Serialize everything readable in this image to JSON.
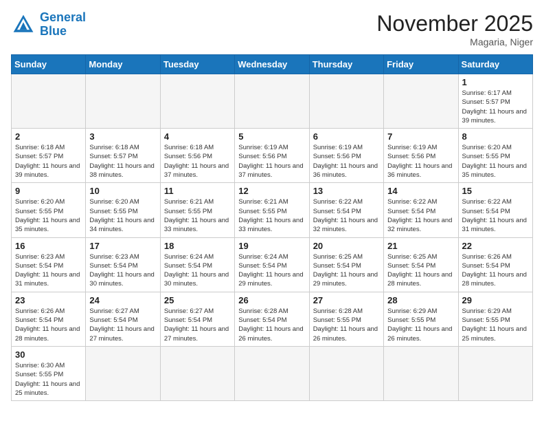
{
  "header": {
    "logo_general": "General",
    "logo_blue": "Blue",
    "month_title": "November 2025",
    "location": "Magaria, Niger"
  },
  "days_of_week": [
    "Sunday",
    "Monday",
    "Tuesday",
    "Wednesday",
    "Thursday",
    "Friday",
    "Saturday"
  ],
  "weeks": [
    {
      "cells": [
        {
          "day": "",
          "empty": true
        },
        {
          "day": "",
          "empty": true
        },
        {
          "day": "",
          "empty": true
        },
        {
          "day": "",
          "empty": true
        },
        {
          "day": "",
          "empty": true
        },
        {
          "day": "",
          "empty": true
        },
        {
          "day": "1",
          "sunrise": "6:17 AM",
          "sunset": "5:57 PM",
          "daylight": "11 hours and 39 minutes."
        }
      ]
    },
    {
      "cells": [
        {
          "day": "2",
          "sunrise": "6:18 AM",
          "sunset": "5:57 PM",
          "daylight": "11 hours and 39 minutes."
        },
        {
          "day": "3",
          "sunrise": "6:18 AM",
          "sunset": "5:57 PM",
          "daylight": "11 hours and 38 minutes."
        },
        {
          "day": "4",
          "sunrise": "6:18 AM",
          "sunset": "5:56 PM",
          "daylight": "11 hours and 37 minutes."
        },
        {
          "day": "5",
          "sunrise": "6:19 AM",
          "sunset": "5:56 PM",
          "daylight": "11 hours and 37 minutes."
        },
        {
          "day": "6",
          "sunrise": "6:19 AM",
          "sunset": "5:56 PM",
          "daylight": "11 hours and 36 minutes."
        },
        {
          "day": "7",
          "sunrise": "6:19 AM",
          "sunset": "5:56 PM",
          "daylight": "11 hours and 36 minutes."
        },
        {
          "day": "8",
          "sunrise": "6:20 AM",
          "sunset": "5:55 PM",
          "daylight": "11 hours and 35 minutes."
        }
      ]
    },
    {
      "cells": [
        {
          "day": "9",
          "sunrise": "6:20 AM",
          "sunset": "5:55 PM",
          "daylight": "11 hours and 35 minutes."
        },
        {
          "day": "10",
          "sunrise": "6:20 AM",
          "sunset": "5:55 PM",
          "daylight": "11 hours and 34 minutes."
        },
        {
          "day": "11",
          "sunrise": "6:21 AM",
          "sunset": "5:55 PM",
          "daylight": "11 hours and 33 minutes."
        },
        {
          "day": "12",
          "sunrise": "6:21 AM",
          "sunset": "5:55 PM",
          "daylight": "11 hours and 33 minutes."
        },
        {
          "day": "13",
          "sunrise": "6:22 AM",
          "sunset": "5:54 PM",
          "daylight": "11 hours and 32 minutes."
        },
        {
          "day": "14",
          "sunrise": "6:22 AM",
          "sunset": "5:54 PM",
          "daylight": "11 hours and 32 minutes."
        },
        {
          "day": "15",
          "sunrise": "6:22 AM",
          "sunset": "5:54 PM",
          "daylight": "11 hours and 31 minutes."
        }
      ]
    },
    {
      "cells": [
        {
          "day": "16",
          "sunrise": "6:23 AM",
          "sunset": "5:54 PM",
          "daylight": "11 hours and 31 minutes."
        },
        {
          "day": "17",
          "sunrise": "6:23 AM",
          "sunset": "5:54 PM",
          "daylight": "11 hours and 30 minutes."
        },
        {
          "day": "18",
          "sunrise": "6:24 AM",
          "sunset": "5:54 PM",
          "daylight": "11 hours and 30 minutes."
        },
        {
          "day": "19",
          "sunrise": "6:24 AM",
          "sunset": "5:54 PM",
          "daylight": "11 hours and 29 minutes."
        },
        {
          "day": "20",
          "sunrise": "6:25 AM",
          "sunset": "5:54 PM",
          "daylight": "11 hours and 29 minutes."
        },
        {
          "day": "21",
          "sunrise": "6:25 AM",
          "sunset": "5:54 PM",
          "daylight": "11 hours and 28 minutes."
        },
        {
          "day": "22",
          "sunrise": "6:26 AM",
          "sunset": "5:54 PM",
          "daylight": "11 hours and 28 minutes."
        }
      ]
    },
    {
      "cells": [
        {
          "day": "23",
          "sunrise": "6:26 AM",
          "sunset": "5:54 PM",
          "daylight": "11 hours and 28 minutes."
        },
        {
          "day": "24",
          "sunrise": "6:27 AM",
          "sunset": "5:54 PM",
          "daylight": "11 hours and 27 minutes."
        },
        {
          "day": "25",
          "sunrise": "6:27 AM",
          "sunset": "5:54 PM",
          "daylight": "11 hours and 27 minutes."
        },
        {
          "day": "26",
          "sunrise": "6:28 AM",
          "sunset": "5:54 PM",
          "daylight": "11 hours and 26 minutes."
        },
        {
          "day": "27",
          "sunrise": "6:28 AM",
          "sunset": "5:55 PM",
          "daylight": "11 hours and 26 minutes."
        },
        {
          "day": "28",
          "sunrise": "6:29 AM",
          "sunset": "5:55 PM",
          "daylight": "11 hours and 26 minutes."
        },
        {
          "day": "29",
          "sunrise": "6:29 AM",
          "sunset": "5:55 PM",
          "daylight": "11 hours and 25 minutes."
        }
      ]
    },
    {
      "cells": [
        {
          "day": "30",
          "sunrise": "6:30 AM",
          "sunset": "5:55 PM",
          "daylight": "11 hours and 25 minutes."
        },
        {
          "day": "",
          "empty": true
        },
        {
          "day": "",
          "empty": true
        },
        {
          "day": "",
          "empty": true
        },
        {
          "day": "",
          "empty": true
        },
        {
          "day": "",
          "empty": true
        },
        {
          "day": "",
          "empty": true
        }
      ]
    }
  ]
}
